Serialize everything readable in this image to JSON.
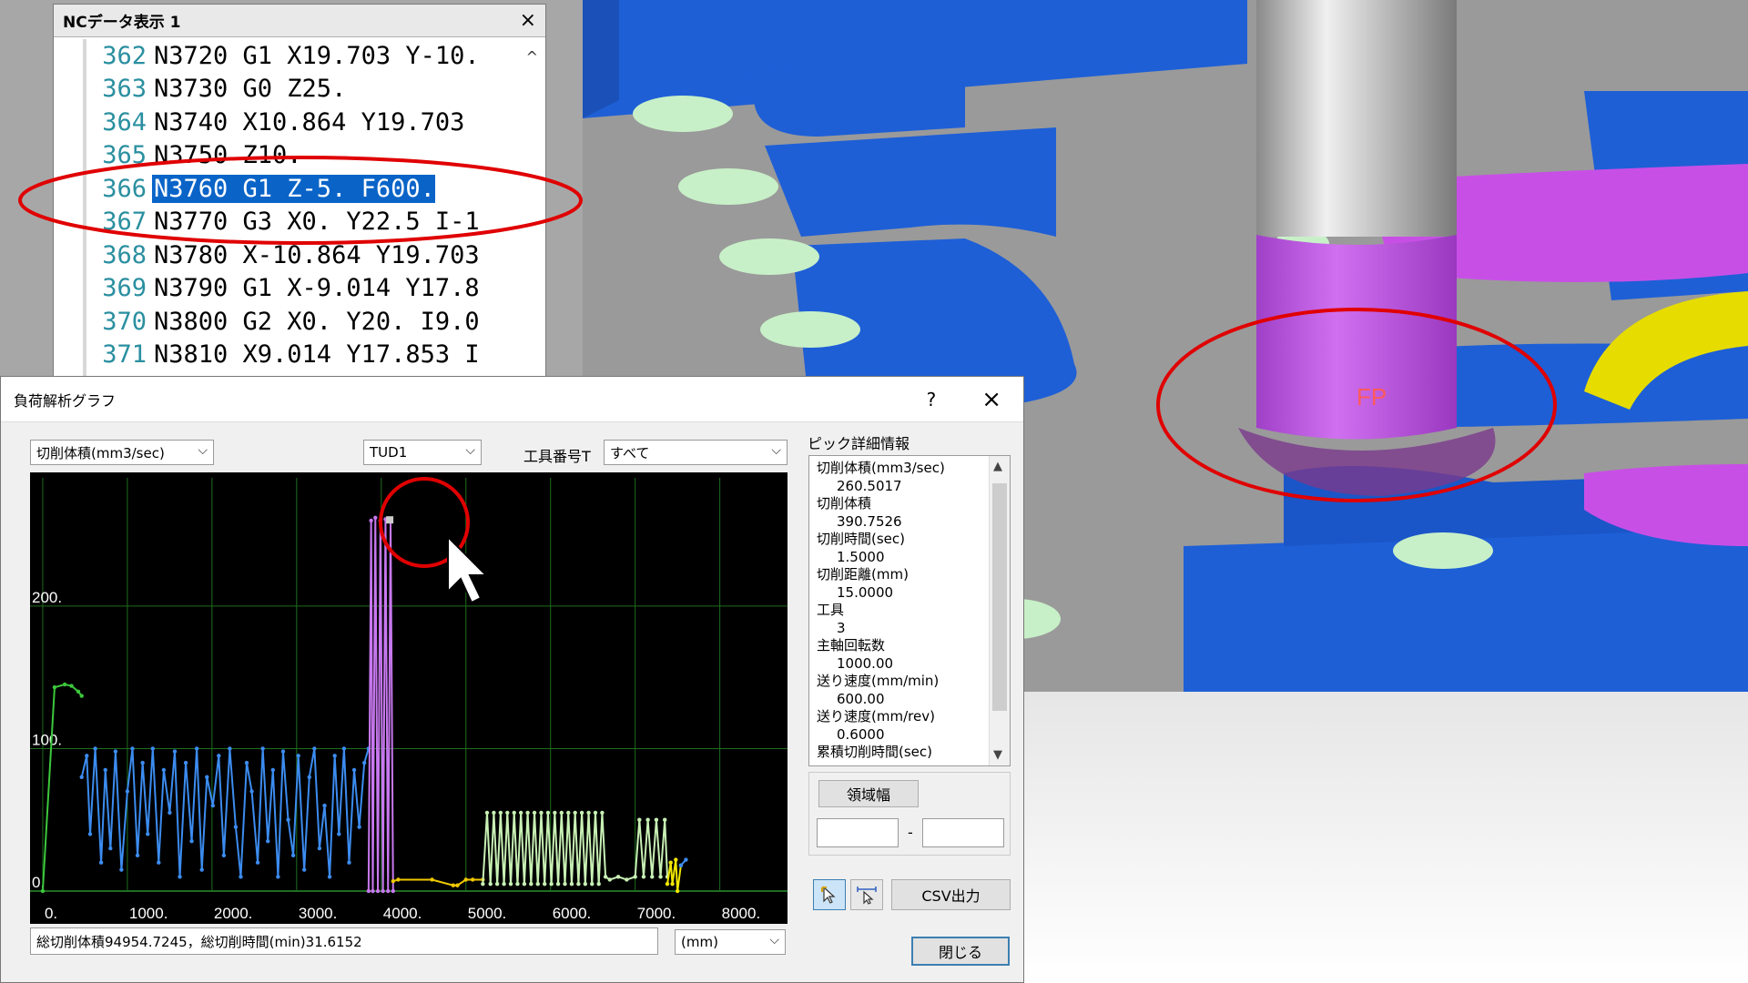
{
  "nc_window": {
    "title": "NCデータ表示 1",
    "close": "×",
    "scroll_up": "^",
    "lines": [
      {
        "num": "362",
        "text": "N3720 G1 X19.703 Y-10.",
        "selected": false
      },
      {
        "num": "363",
        "text": "N3730 G0 Z25.",
        "selected": false
      },
      {
        "num": "364",
        "text": "N3740 X10.864 Y19.703",
        "selected": false
      },
      {
        "num": "365",
        "text": "N3750 Z10.",
        "selected": false
      },
      {
        "num": "366",
        "text": "N3760 G1 Z-5. F600.",
        "selected": true
      },
      {
        "num": "367",
        "text": "N3770 G3 X0. Y22.5 I-1",
        "selected": false
      },
      {
        "num": "368",
        "text": "N3780 X-10.864 Y19.703",
        "selected": false
      },
      {
        "num": "369",
        "text": "N3790 G1 X-9.014 Y17.8",
        "selected": false
      },
      {
        "num": "370",
        "text": "N3800 G2 X0. Y20. I9.0",
        "selected": false
      },
      {
        "num": "371",
        "text": "N3810 X9.014 Y17.853 I",
        "selected": false
      }
    ]
  },
  "dialog": {
    "title": "負荷解析グラフ",
    "help": "?",
    "close": "×",
    "metric_select": "切削体積(mm3/sec)",
    "tool_select": "TUD1",
    "tool_number_label": "工具番号T",
    "tool_number_select": "すべて",
    "summary": "総切削体積94954.7245，総切削時間(min)31.6152",
    "unit_select": "(mm)",
    "pick_label": "ピック詳細情報",
    "pick_items": [
      {
        "label": "切削体積(mm3/sec)",
        "value": "260.5017"
      },
      {
        "label": "切削体積",
        "value": "390.7526"
      },
      {
        "label": "切削時間(sec)",
        "value": "1.5000"
      },
      {
        "label": "切削距離(mm)",
        "value": "15.0000"
      },
      {
        "label": "工具",
        "value": "3"
      },
      {
        "label": "主軸回転数",
        "value": "1000.00"
      },
      {
        "label": "送り速度(mm/min)",
        "value": "600.00"
      },
      {
        "label": "送り速度(mm/rev)",
        "value": "0.6000"
      },
      {
        "label": "累積切削時間(sec)",
        "value": ""
      }
    ],
    "range_button": "領域幅",
    "range_sep": "-",
    "csv_button": "CSV出力",
    "close_button": "閉じる"
  },
  "viewport": {
    "fp_label": "FP"
  },
  "colors": {
    "blue_pocket": "#1e5fd6",
    "gray_surface": "#9a9a9a",
    "magenta": "#c84fe6",
    "yellow": "#e6dc00",
    "annotation_red": "#e00000",
    "selection": "#0a64c8"
  },
  "chart_data": {
    "type": "line",
    "xlabel": "",
    "ylabel": "",
    "xlim": [
      -150,
      8800
    ],
    "ylim": [
      0,
      290
    ],
    "x_ticks": [
      "0.",
      "1000.",
      "2000.",
      "3000.",
      "4000.",
      "5000.",
      "6000.",
      "7000.",
      "8000."
    ],
    "y_ticks": [
      "0.",
      "100.",
      "200."
    ],
    "series": [
      {
        "color": "#3cc83c",
        "x": [
          0,
          140,
          260,
          340,
          420,
          460
        ],
        "y": [
          0,
          143,
          145,
          144,
          140,
          137
        ]
      },
      {
        "color": "#3c8cf0",
        "x": [
          460,
          520,
          560,
          620,
          690,
          740,
          800,
          860,
          930,
          1000,
          1060,
          1120,
          1180,
          1240,
          1300,
          1370,
          1430,
          1500,
          1560,
          1620,
          1690,
          1760,
          1820,
          1880,
          1940,
          2010,
          2080,
          2140,
          2210,
          2280,
          2340,
          2410,
          2470,
          2540,
          2600,
          2660,
          2720,
          2780,
          2840,
          2900,
          2960,
          3020,
          3090,
          3150,
          3210,
          3270,
          3330,
          3390,
          3450,
          3500,
          3560,
          3620,
          3680,
          3740,
          3800,
          3850
        ],
        "y": [
          80,
          95,
          40,
          100,
          20,
          85,
          30,
          98,
          15,
          70,
          100,
          25,
          90,
          40,
          100,
          20,
          85,
          55,
          98,
          10,
          90,
          35,
          100,
          15,
          80,
          60,
          95,
          25,
          100,
          45,
          10,
          90,
          70,
          20,
          100,
          35,
          85,
          10,
          98,
          50,
          25,
          95,
          15,
          80,
          100,
          30,
          60,
          10,
          95,
          40,
          100,
          20,
          85,
          45,
          90,
          100
        ]
      },
      {
        "color": "#c878f0",
        "x": [
          3850,
          3880,
          3900,
          3930,
          3960,
          3990,
          4020,
          4050,
          4080,
          4110,
          4140
        ],
        "y": [
          0,
          260,
          0,
          262,
          0,
          260,
          0,
          261,
          0,
          260,
          0
        ]
      },
      {
        "color": "#f0c800",
        "x": [
          4140,
          4200,
          4600,
          4850,
          4900,
          5000,
          5080,
          5200
        ],
        "y": [
          7,
          8,
          8,
          4,
          4,
          8,
          8,
          8
        ]
      },
      {
        "color": "#c8f0b4",
        "x": [
          5200,
          5250,
          5290,
          5330,
          5370,
          5410,
          5450,
          5490,
          5530,
          5570,
          5610,
          5650,
          5690,
          5730,
          5770,
          5810,
          5850,
          5890,
          5930,
          5970,
          6010,
          6050,
          6090,
          6130,
          6170,
          6210,
          6250,
          6290,
          6330,
          6370,
          6410,
          6450,
          6490,
          6530,
          6570,
          6610,
          6650,
          6700,
          6800,
          6900,
          7000,
          7050,
          7100,
          7150,
          7200,
          7250,
          7300,
          7350,
          7380
        ],
        "y": [
          5,
          55,
          5,
          55,
          5,
          55,
          5,
          55,
          5,
          55,
          5,
          55,
          5,
          55,
          5,
          55,
          5,
          55,
          5,
          55,
          5,
          55,
          5,
          55,
          5,
          55,
          5,
          55,
          5,
          55,
          5,
          55,
          5,
          55,
          5,
          55,
          10,
          8,
          10,
          8,
          10,
          50,
          10,
          50,
          10,
          50,
          10,
          50,
          10
        ]
      },
      {
        "color": "#f0e600",
        "x": [
          7380,
          7420,
          7440,
          7480,
          7500,
          7540
        ],
        "y": [
          5,
          20,
          5,
          22,
          0,
          18
        ]
      },
      {
        "color": "#3c8cf0",
        "x": [
          7540,
          7600
        ],
        "y": [
          18,
          22
        ]
      }
    ],
    "pick_point": {
      "x": 4100,
      "y": 260.5
    }
  }
}
